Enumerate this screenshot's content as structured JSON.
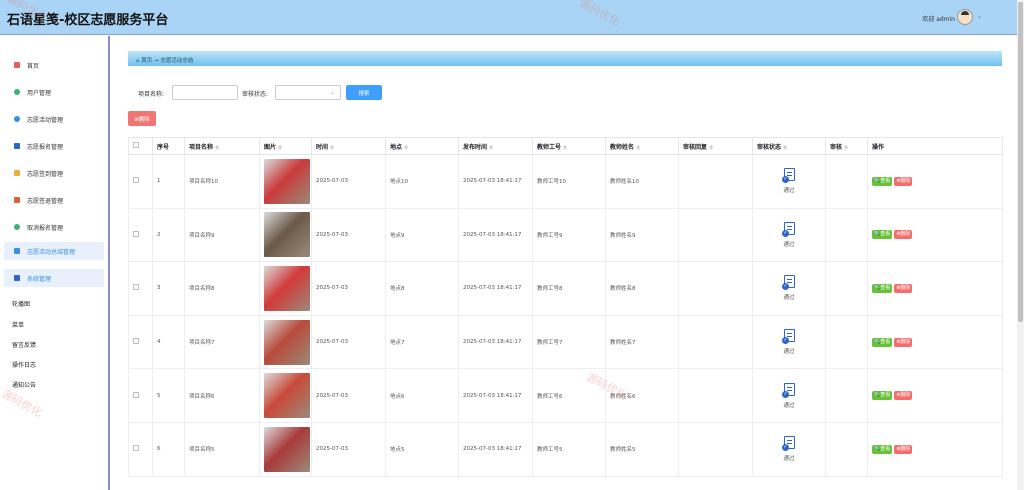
{
  "header": {
    "title": "石语星笺-校区志愿服务平台",
    "welcome": "欢迎 admin",
    "caret": "⌄"
  },
  "sidebar": {
    "items": [
      {
        "label": "首页",
        "icon": "home-icon",
        "color": "#e35d5d"
      },
      {
        "label": "用户管理",
        "icon": "user-icon",
        "color": "#3cb371"
      },
      {
        "label": "志愿活动管理",
        "icon": "circle-icon",
        "color": "#3a8ee6"
      },
      {
        "label": "志愿报名管理",
        "icon": "card-icon",
        "color": "#2f64c8"
      },
      {
        "label": "志愿签到管理",
        "icon": "folder-icon",
        "color": "#e6b23a"
      },
      {
        "label": "志愿签退管理",
        "icon": "grid-icon",
        "color": "#e35d3a"
      },
      {
        "label": "取消报名管理",
        "icon": "dot-icon",
        "color": "#3cb371"
      },
      {
        "label": "志愿活动总结管理",
        "icon": "grid-icon",
        "color": "#3a8ee6"
      },
      {
        "label": "系统管理",
        "icon": "grid-icon",
        "color": "#2f64c8"
      }
    ],
    "sub_items": [
      "轮播图",
      "菜单",
      "留言反馈",
      "操作日志",
      "通知公告"
    ]
  },
  "breadcrumb": {
    "home": "⌂ 首页",
    "sep": "→",
    "current": "志愿活动总结"
  },
  "search": {
    "name_label": "项目名称:",
    "status_label": "审核状态:",
    "button": "搜索"
  },
  "batch_delete": "⊗删除",
  "table": {
    "headers": [
      "序号",
      "项目名称",
      "图片",
      "时间",
      "地点",
      "发布时间",
      "教师工号",
      "教师姓名",
      "审核回复",
      "审核状态",
      "审核",
      "操作"
    ],
    "sort_mark": "≑",
    "view_label": "🔍查看",
    "delete_label": "⊗删除",
    "rows": [
      {
        "idx": "1",
        "name": "项目名称10",
        "time": "2025-07-03",
        "place": "地点10",
        "pub": "2025-07-03 18:41:17",
        "tno": "教师工号10",
        "tname": "教师姓名10",
        "reply": "",
        "status": "通过",
        "img": "#c93a3a"
      },
      {
        "idx": "2",
        "name": "项目名称9",
        "time": "2025-07-03",
        "place": "地点9",
        "pub": "2025-07-03 18:41:17",
        "tno": "教师工号9",
        "tname": "教师姓名9",
        "reply": "",
        "status": "通过",
        "img": "#6b5a4a"
      },
      {
        "idx": "3",
        "name": "项目名称8",
        "time": "2025-07-03",
        "place": "地点8",
        "pub": "2025-07-03 18:41:17",
        "tno": "教师工号8",
        "tname": "教师姓名8",
        "reply": "",
        "status": "通过",
        "img": "#d23a3a"
      },
      {
        "idx": "4",
        "name": "项目名称7",
        "time": "2025-07-03",
        "place": "地点7",
        "pub": "2025-07-03 18:41:17",
        "tno": "教师工号7",
        "tname": "教师姓名7",
        "reply": "",
        "status": "通过",
        "img": "#b84a3a"
      },
      {
        "idx": "5",
        "name": "项目名称6",
        "time": "2025-07-03",
        "place": "地点6",
        "pub": "2025-07-03 18:41:17",
        "tno": "教师工号6",
        "tname": "教师姓名6",
        "reply": "",
        "status": "通过",
        "img": "#c94a3a"
      },
      {
        "idx": "6",
        "name": "项目名称5",
        "time": "2025-07-03",
        "place": "地点5",
        "pub": "2025-07-03 18:41:17",
        "tno": "教师工号5",
        "tname": "教师姓名5",
        "reply": "",
        "status": "通过",
        "img": "#a83a3a"
      }
    ]
  },
  "watermark": "源码优化"
}
